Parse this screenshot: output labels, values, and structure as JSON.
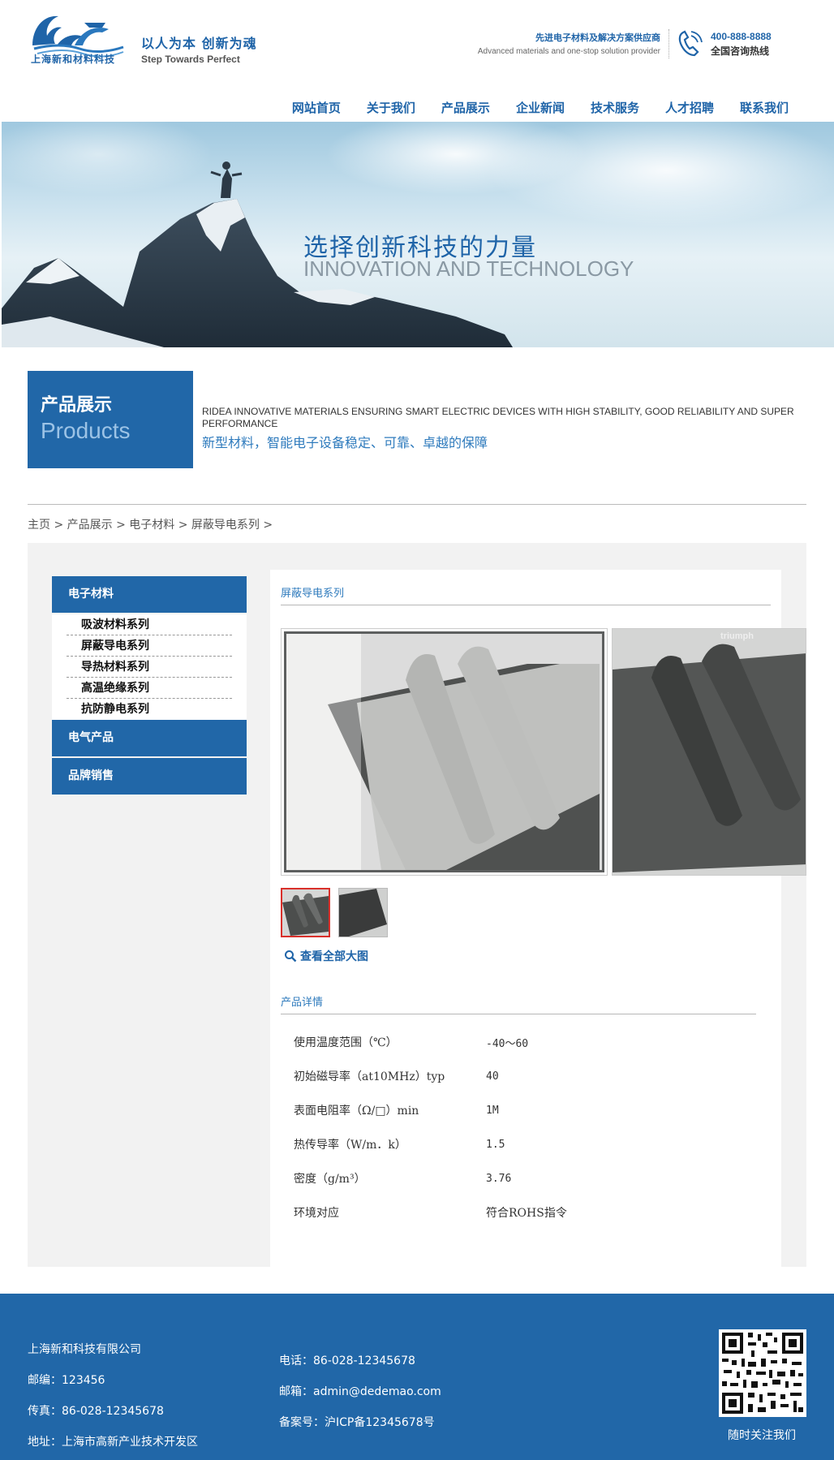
{
  "header": {
    "logo_text": "上海新和材料科技",
    "slogan_cn": "以人为本 创新为魂",
    "slogan_en": "Step Towards Perfect",
    "provider_cn": "先进电子材料及解决方案供应商",
    "provider_en": "Advanced materials and one-stop solution provider",
    "hotline_number": "400-888-8888",
    "hotline_label": "全国咨询热线",
    "logo_icon": "wave-horse-logo",
    "phone_icon": "phone-icon"
  },
  "nav": {
    "items": [
      "网站首页",
      "关于我们",
      "产品展示",
      "企业新闻",
      "技术服务",
      "人才招聘",
      "联系我们"
    ]
  },
  "banner": {
    "title_cn": "选择创新科技的力量",
    "title_en": "INNOVATION AND TECHNOLOGY"
  },
  "section": {
    "title_cn": "产品展示",
    "title_en": "Products",
    "desc_en": "RIDEA INNOVATIVE MATERIALS ENSURING SMART ELECTRIC DEVICES WITH HIGH STABILITY, GOOD RELIABILITY AND SUPER PERFORMANCE",
    "desc_cn": "新型材料，智能电子设备稳定、可靠、卓越的保障"
  },
  "breadcrumb": {
    "items": [
      "主页",
      "产品展示",
      "电子材料",
      "屏蔽导电系列"
    ],
    "separator": ">"
  },
  "sidebar": {
    "groups": [
      {
        "label": "电子材料",
        "items": [
          "吸波材料系列",
          "屏蔽导电系列",
          "导热材料系列",
          "高温绝缘系列",
          "抗防静电系列"
        ]
      },
      {
        "label": "电气产品",
        "items": []
      },
      {
        "label": "品牌销售",
        "items": []
      }
    ]
  },
  "product": {
    "category_title": "屏蔽导电系列",
    "image_watermark": "triumph",
    "view_all_label": "查看全部大图",
    "details_title": "产品详情",
    "specs": [
      {
        "name": "使用温度范围（℃）",
        "value": "-40～60"
      },
      {
        "name": "初始磁导率（at10MHz）typ",
        "value": "40"
      },
      {
        "name": "表面电阻率（Ω/□）min",
        "value": "1M"
      },
      {
        "name": "热传导率（W/m．k）",
        "value": "1.5"
      },
      {
        "name": "密度（g/m³）",
        "value": "3.76"
      },
      {
        "name": "环境对应",
        "value": "符合ROHS指令"
      }
    ]
  },
  "footer": {
    "company": "上海新和科技有限公司",
    "postcode": "邮编：123456",
    "fax": "传真：86-028-12345678",
    "address": "地址：上海市高新产业技术开发区",
    "phone": "电话：86-028-12345678",
    "email": "邮箱：admin@dedemao.com",
    "icp": "备案号：沪ICP备12345678号",
    "qr_label": "随时关注我们"
  },
  "colors": {
    "brand_blue": "#2167a8",
    "light_blue_text": "#2f7bbd",
    "active_thumb_border": "#d9302b"
  }
}
